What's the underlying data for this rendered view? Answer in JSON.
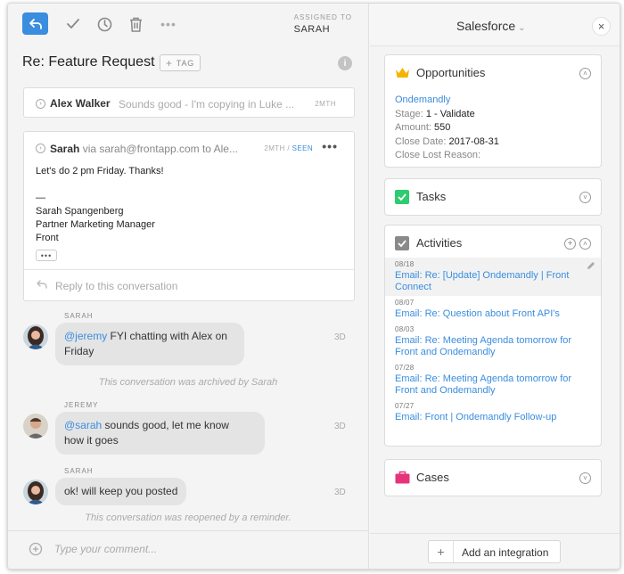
{
  "toolbar": {
    "assigned_label": "ASSIGNED TO",
    "assigned_name": "SARAH"
  },
  "conversation": {
    "subject": "Re: Feature Request",
    "tag_label": "TAG"
  },
  "messages": [
    {
      "sender": "Alex Walker",
      "snippet": "Sounds good - I'm copying in Luke ...",
      "time": "2MTH"
    },
    {
      "sender": "Sarah",
      "via": "via",
      "address": "sarah@frontapp.com to Ale...",
      "time": "2MTH /",
      "seen": "SEEN",
      "body": [
        "Let's do 2 pm Friday. Thanks!",
        "",
        "—",
        "Sarah Spangenberg",
        "Partner Marketing Manager",
        "Front"
      ],
      "reply_placeholder": "Reply to this conversation"
    }
  ],
  "chat": [
    {
      "author": "SARAH",
      "mention": "@jeremy",
      "line1": " FYI chatting with Alex on",
      "line2": "Friday",
      "time": "3D"
    },
    {
      "note": "This conversation was archived by Sarah"
    },
    {
      "author": "JEREMY",
      "mention": "@sarah",
      "line1": " sounds good, let me know",
      "line2": "how it goes",
      "time": "3D"
    },
    {
      "author": "SARAH",
      "text": "ok! will keep you posted",
      "time": "3D"
    },
    {
      "note": "This conversation was reopened by a reminder."
    }
  ],
  "comment": {
    "placeholder": "Type your comment..."
  },
  "sidebar": {
    "title": "Salesforce",
    "opportunities": {
      "title": "Opportunities",
      "name": "Ondemandly",
      "stage_label": "Stage:",
      "stage_value": "1 - Validate",
      "amount_label": "Amount:",
      "amount_value": "550",
      "close_date_label": "Close Date:",
      "close_date_value": "2017-08-31",
      "close_lost_label": "Close Lost Reason:"
    },
    "tasks": {
      "title": "Tasks"
    },
    "activities": {
      "title": "Activities",
      "items": [
        {
          "date": "08/18",
          "title1": "Email: Re: [Update] Ondemandly | Front",
          "title2": "Connect"
        },
        {
          "date": "08/07",
          "title1": "Email: Re: Question about Front API's",
          "title2": ""
        },
        {
          "date": "08/03",
          "title1": "Email: Re: Meeting Agenda tomorrow for",
          "title2": "Front and Ondemandly"
        },
        {
          "date": "07/28",
          "title1": "Email: Re: Meeting Agenda tomorrow for",
          "title2": "Front and Ondemandly"
        },
        {
          "date": "07/27",
          "title1": "Email: Front | Ondemandly Follow-up",
          "title2": ""
        }
      ]
    },
    "cases": {
      "title": "Cases"
    },
    "add_integration": "Add an integration"
  },
  "colors": {
    "accent": "#3a8ddf",
    "opportunities_icon": "#f5b400",
    "tasks_icon": "#2ecc71",
    "activities_icon": "#8a8a8a",
    "cases_icon": "#e5347a"
  }
}
